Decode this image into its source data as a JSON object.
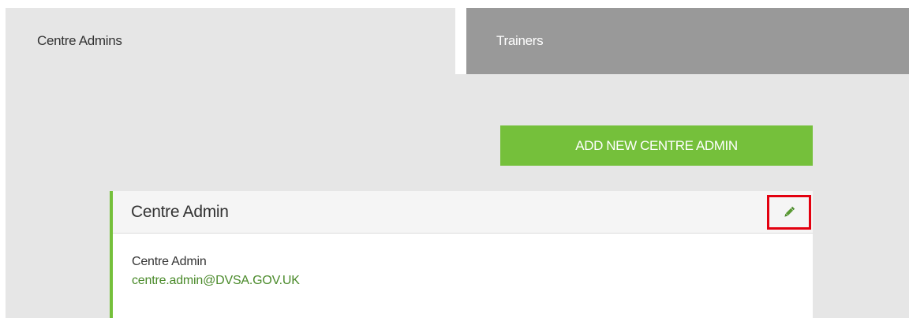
{
  "tabs": {
    "centre_admins": "Centre Admins",
    "trainers": "Trainers"
  },
  "actions": {
    "add_new_label": "ADD NEW CENTRE ADMIN"
  },
  "card": {
    "title": "Centre Admin",
    "name": "Centre Admin",
    "email": "centre.admin@DVSA.GOV.UK",
    "edit_icon": "pencil-icon"
  },
  "colors": {
    "accent_green": "#75c03b",
    "link_green": "#4a8a2a",
    "highlight_red": "#e3000f",
    "inactive_tab": "#999999",
    "panel_bg": "#e6e6e6"
  }
}
